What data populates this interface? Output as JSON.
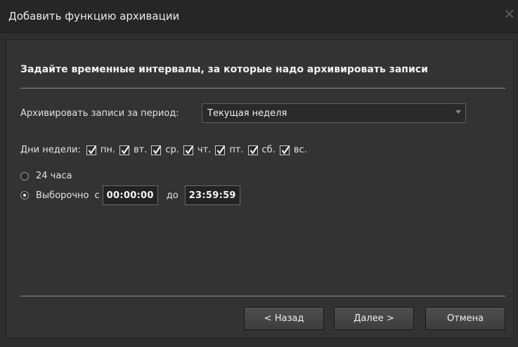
{
  "window": {
    "title": "Добавить функцию архивации",
    "close_icon": "close-icon"
  },
  "heading": "Задайте временные интервалы, за которые надо архивировать записи",
  "period": {
    "label": "Архивировать записи за период:",
    "selected": "Текущая неделя"
  },
  "days": {
    "label": "Дни недели:",
    "items": [
      {
        "label": "пн.",
        "checked": true
      },
      {
        "label": "вт.",
        "checked": true
      },
      {
        "label": "ср.",
        "checked": true
      },
      {
        "label": "чт.",
        "checked": true
      },
      {
        "label": "пт.",
        "checked": true
      },
      {
        "label": "сб.",
        "checked": true
      },
      {
        "label": "вс.",
        "checked": true
      }
    ]
  },
  "schedule": {
    "option_24h": "24 часа",
    "option_custom": "Выборочно",
    "selected": "custom",
    "from_label": "с",
    "from_value": "00:00:00",
    "to_label": "до",
    "to_value": "23:59:59"
  },
  "buttons": {
    "back": "< Назад",
    "next": "Далее >",
    "cancel": "Отмена"
  }
}
